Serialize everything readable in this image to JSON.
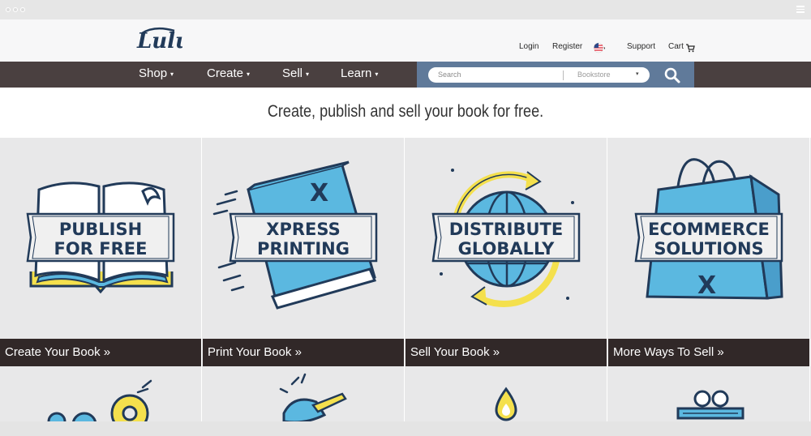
{
  "header": {
    "logo_text": "Lulu",
    "links": {
      "login": "Login",
      "register": "Register",
      "support": "Support",
      "cart": "Cart"
    }
  },
  "nav": {
    "items": [
      "Shop",
      "Create",
      "Sell",
      "Learn"
    ],
    "caret": "▾",
    "search": {
      "placeholder": "Search",
      "scope": "Bookstore",
      "scope_caret": "▾"
    }
  },
  "tagline": "Create, publish and sell your book for free.",
  "tiles": [
    {
      "icon": "open-book-icon",
      "banner_line1": "PUBLISH",
      "banner_line2": "FOR FREE",
      "link": "Create Your Book »"
    },
    {
      "icon": "book-cover-x-icon",
      "banner_line1": "XPRESS",
      "banner_line2": "PRINTING",
      "link": "Print Your Book »"
    },
    {
      "icon": "globe-icon",
      "banner_line1": "DISTRIBUTE",
      "banner_line2": "GLOBALLY",
      "link": "Sell Your Book »"
    },
    {
      "icon": "shopping-bag-icon",
      "banner_line1": "ECOMMERCE",
      "banner_line2": "SOLUTIONS",
      "link": "More Ways To Sell »"
    }
  ],
  "bottom_icons": [
    "gears-icon",
    "hand-pencil-icon",
    "flame-icon",
    "books-glasses-icon"
  ],
  "colors": {
    "nav_bg": "#4a4040",
    "search_band": "#607a9a",
    "link_bar": "#312828",
    "brand_navy": "#213a59",
    "accent_blue": "#5bb8e0",
    "accent_yellow": "#f4e04d"
  }
}
